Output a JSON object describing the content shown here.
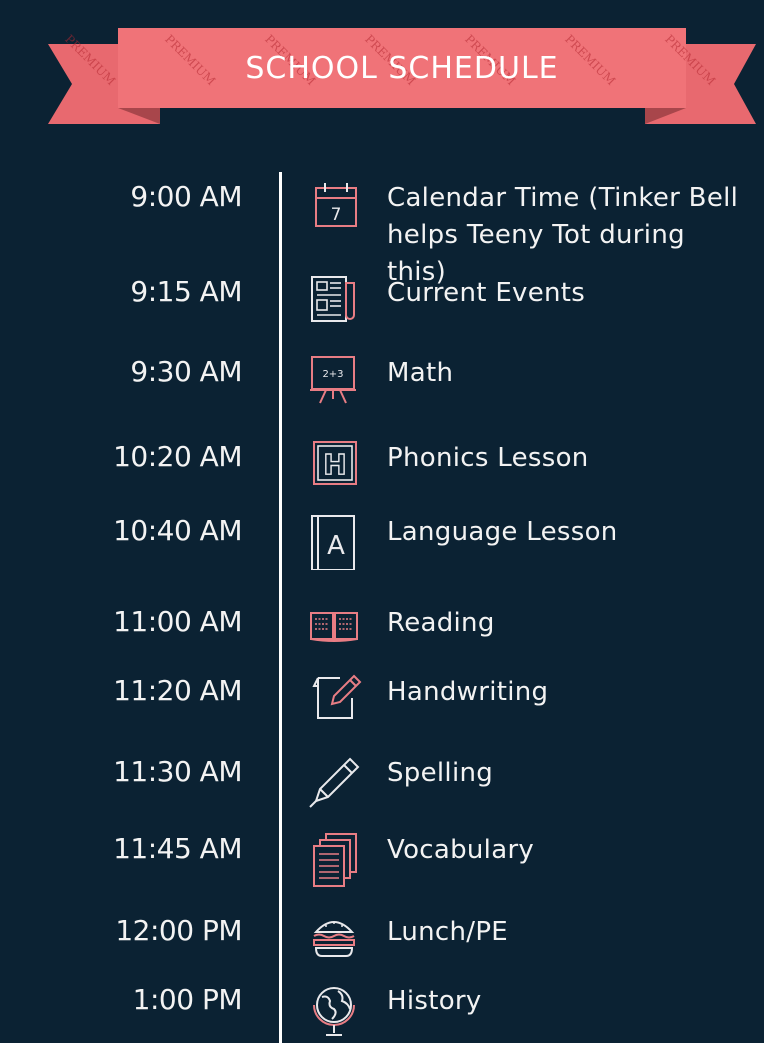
{
  "banner": {
    "title": "SCHOOL SCHEDULE",
    "watermark": "PREMIUM",
    "ribbon_color": "#f07378",
    "ribbon_dark": "#c45358"
  },
  "colors": {
    "background": "#0b2233",
    "icon_pink": "#e87d84",
    "icon_white": "#e9e9ec",
    "line": "#ffffff"
  },
  "schedule": [
    {
      "time": "9:00 AM",
      "activity_line1": "Calendar Time (Tinker Bell",
      "activity_line2": "helps Teeny Tot during this)",
      "icon": "calendar-icon",
      "calendar_day": "7"
    },
    {
      "time": "9:15 AM",
      "activity_line1": "Current Events",
      "icon": "newspaper-icon"
    },
    {
      "time": "9:30 AM",
      "activity_line1": "Math",
      "icon": "chalkboard-icon",
      "board_text": "2+3"
    },
    {
      "time": "10:20 AM",
      "activity_line1": "Phonics Lesson",
      "icon": "letter-block-icon",
      "block_letter": "H"
    },
    {
      "time": "10:40 AM",
      "activity_line1": "Language Lesson",
      "icon": "book-letter-icon",
      "book_letter": "A"
    },
    {
      "time": "11:00 AM",
      "activity_line1": "Reading",
      "icon": "open-book-icon"
    },
    {
      "time": "11:20 AM",
      "activity_line1": "Handwriting",
      "icon": "paper-pen-icon"
    },
    {
      "time": "11:30 AM",
      "activity_line1": "Spelling",
      "icon": "pencil-icon"
    },
    {
      "time": "11:45 AM",
      "activity_line1": "Vocabulary",
      "icon": "documents-icon"
    },
    {
      "time": "12:00 PM",
      "activity_line1": "Lunch/PE",
      "icon": "burger-icon"
    },
    {
      "time": "1:00 PM",
      "activity_line1": "History",
      "icon": "globe-icon"
    }
  ]
}
